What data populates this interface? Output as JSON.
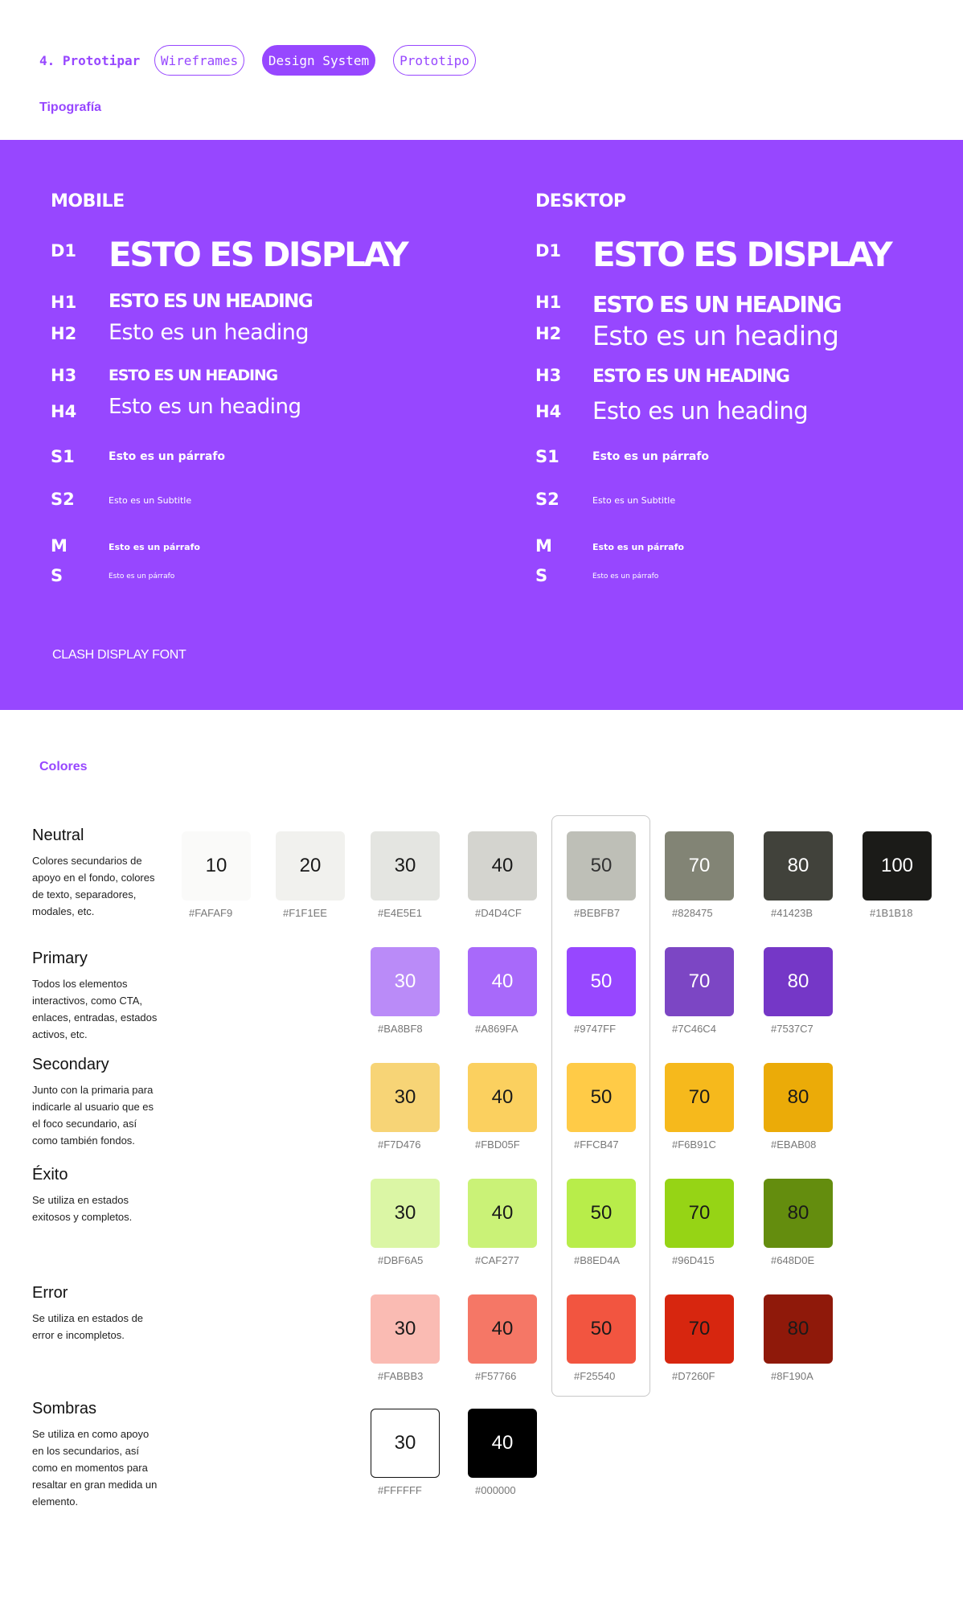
{
  "nav": {
    "step": "4. Prototipar",
    "tabs": [
      "Wireframes",
      "Design System",
      "Prototipo"
    ],
    "active_tab": "Design System"
  },
  "typography": {
    "section_label": "Tipografía",
    "mobile": {
      "title": "MOBILE",
      "d1_label": "D1",
      "d1_text": "ESTO ES DISPLAY",
      "h1_label": "H1",
      "h1_text": "ESTO ES UN HEADING",
      "h2_label": "H2",
      "h2_text": "Esto es un heading",
      "h3_label": "H3",
      "h3_text": "ESTO ES UN HEADING",
      "h4_label": "H4",
      "h4_text": "Esto es un heading",
      "s1_label": "S1",
      "s1_text": "Esto es un párrafo",
      "s2_label": "S2",
      "s2_text": "Esto es un Subtitle",
      "m_label": "M",
      "m_text": "Esto es un párrafo",
      "s_label": "S",
      "s_text": "Esto es un párrafo"
    },
    "desktop": {
      "title": "DESKTOP",
      "d1_label": "D1",
      "d1_text": "ESTO ES DISPLAY",
      "h1_label": "H1",
      "h1_text": "ESTO ES UN HEADING",
      "h2_label": "H2",
      "h2_text": "Esto es un heading",
      "h3_label": "H3",
      "h3_text": "ESTO ES UN HEADING",
      "h4_label": "H4",
      "h4_text": "Esto es un heading",
      "s1_label": "S1",
      "s1_text": "Esto es un párrafo",
      "s2_label": "S2",
      "s2_text": "Esto es un Subtitle",
      "m_label": "M",
      "m_text": "Esto es un párrafo",
      "s_label": "S",
      "s_text": "Esto es un párrafo"
    },
    "font_note": "CLASH DISPLAY FONT",
    "background": "#9747FF"
  },
  "colors": {
    "section_label": "Colores",
    "groups": [
      {
        "name": "Neutral",
        "description": "Colores secundarios de apoyo en el fondo, colores de texto, separadores, modales, etc.",
        "swatches": [
          {
            "label": "10",
            "hex": "#FAFAF9"
          },
          {
            "label": "20",
            "hex": "#F1F1EE"
          },
          {
            "label": "30",
            "hex": "#E4E5E1"
          },
          {
            "label": "40",
            "hex": "#D4D4CF"
          },
          {
            "label": "50",
            "hex": "#BEBFB7"
          },
          {
            "label": "70",
            "hex": "#828475"
          },
          {
            "label": "80",
            "hex": "#41423B"
          },
          {
            "label": "100",
            "hex": "#1B1B18"
          }
        ]
      },
      {
        "name": "Primary",
        "description": "Todos los elementos interactivos, como CTA, enlaces, entradas, estados activos, etc.",
        "swatches": [
          {
            "label": "30",
            "hex": "#BA8BF8"
          },
          {
            "label": "40",
            "hex": "#A869FA"
          },
          {
            "label": "50",
            "hex": "#9747FF"
          },
          {
            "label": "70",
            "hex": "#7C46C4"
          },
          {
            "label": "80",
            "hex": "#7537C7"
          }
        ]
      },
      {
        "name": "Secondary",
        "description": "Junto con la primaria para indicarle al usuario que es el foco secundario, así como también fondos.",
        "swatches": [
          {
            "label": "30",
            "hex": "#F7D476"
          },
          {
            "label": "40",
            "hex": "#FBD05F"
          },
          {
            "label": "50",
            "hex": "#FFCB47"
          },
          {
            "label": "70",
            "hex": "#F6B91C"
          },
          {
            "label": "80",
            "hex": "#EBAB08"
          }
        ]
      },
      {
        "name": "Éxito",
        "description": "Se utiliza en estados exitosos y completos.",
        "swatches": [
          {
            "label": "30",
            "hex": "#DBF6A5"
          },
          {
            "label": "40",
            "hex": "#CAF277"
          },
          {
            "label": "50",
            "hex": "#B8ED4A"
          },
          {
            "label": "70",
            "hex": "#96D415"
          },
          {
            "label": "80",
            "hex": "#648D0E"
          }
        ]
      },
      {
        "name": "Error",
        "description": "Se utiliza en estados de error e incompletos.",
        "swatches": [
          {
            "label": "30",
            "hex": "#FABBB3"
          },
          {
            "label": "40",
            "hex": "#F57766"
          },
          {
            "label": "50",
            "hex": "#F25540"
          },
          {
            "label": "70",
            "hex": "#D7260F"
          },
          {
            "label": "80",
            "hex": "#8F190A"
          }
        ]
      },
      {
        "name": "Sombras",
        "description": "Se utiliza en como apoyo en los secundarios, así como en momentos para resaltar en gran medida un elemento.",
        "swatches": [
          {
            "label": "30",
            "hex": "#FFFFFF"
          },
          {
            "label": "40",
            "hex": "#000000"
          }
        ]
      }
    ]
  }
}
